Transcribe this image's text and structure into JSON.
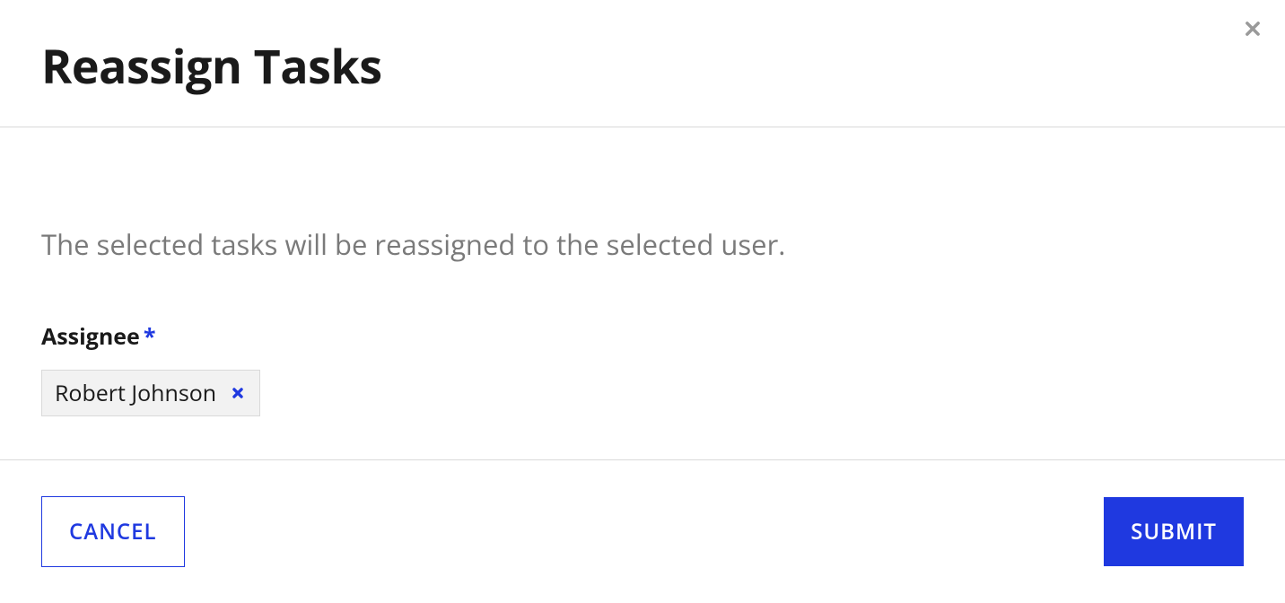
{
  "dialog": {
    "title": "Reassign Tasks",
    "description": "The selected tasks will be reassigned to the selected user.",
    "assignee_label": "Assignee",
    "required_marker": "*",
    "selected_assignee": "Robert Johnson"
  },
  "buttons": {
    "cancel": "CANCEL",
    "submit": "SUBMIT"
  }
}
